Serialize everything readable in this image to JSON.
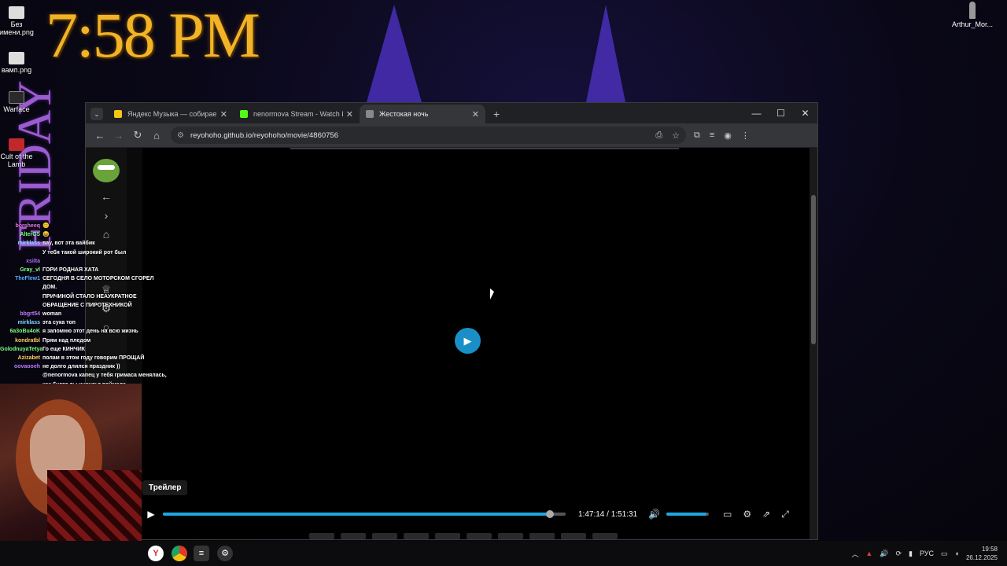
{
  "desktop": {
    "clock": "7:58 PM",
    "day_text": "FRIDAY",
    "icons": [
      {
        "label": "Без имени.png"
      },
      {
        "label": "вамп.png"
      },
      {
        "label": "Warface"
      },
      {
        "label": "Cult of the Lamb"
      }
    ],
    "user": "Arthur_Mor..."
  },
  "browser": {
    "tabs": [
      {
        "title": "Яндекс Музыка — собираем м",
        "color": "#f5c518"
      },
      {
        "title": "nenormova Stream - Watch Liv",
        "color": "#53fc18"
      },
      {
        "title": "Жестокая ночь",
        "color": "#888888",
        "active": true
      }
    ],
    "new_tab": "+",
    "address": "reyohoho.github.io/reyohoho/movie/4860756",
    "window_controls": {
      "minimize": "—",
      "maximize": "☐",
      "close": "✕"
    }
  },
  "player": {
    "trailer_label": "Трейлер",
    "current_time": "1:47:14",
    "separator": "/",
    "duration": "1:51:31",
    "progress": 0.961,
    "volume": 0.95,
    "accent": "#1ea7e0"
  },
  "chat": [
    {
      "user": "borsheeq",
      "msg": "😊",
      "color": "#e07be0"
    },
    {
      "user": "AlterCS",
      "msg": "😆",
      "color": "#7bff7b"
    },
    {
      "user": "mirklass",
      "msg": "вау, вот эта вайбик",
      "color": "#7fd7ff"
    },
    {
      "user": "",
      "msg": "У тебя такой широкий рот был",
      "color": "#ff6a6a"
    },
    {
      "user": "xsiita",
      "msg": "",
      "color": "#b06bff"
    },
    {
      "user": "Gray_vl",
      "msg": "ГОРИ РОДНАЯ ХАТА",
      "color": "#8aff8a"
    },
    {
      "user": "TheFlew1",
      "msg": "СЕГОДНЯ В СЕЛО МОТОРСКОМ СГОРЕЛ ДОМ.",
      "color": "#5ab0ff"
    },
    {
      "user": "",
      "msg": "ПРИЧИНОЙ СТАЛО НЕАУКРАТНОЕ",
      "color": "#5ab0ff"
    },
    {
      "user": "",
      "msg": "ОБРАЩЕНИЕ С ПИРОТЕХНИКОЙ",
      "color": "#5ab0ff"
    },
    {
      "user": "bbgrt54",
      "msg": "woman",
      "color": "#c07bff"
    },
    {
      "user": "mirklass",
      "msg": "эта сука топ",
      "color": "#7fd7ff"
    },
    {
      "user": "6a3oBu4oK",
      "msg": "я запомню этот день на всю жизнь",
      "color": "#7bff7b"
    },
    {
      "user": "kondratbl",
      "msg": "Прям над пледом",
      "color": "#ffcf5a"
    },
    {
      "user": "GolodnuyaTetya",
      "msg": "Го еще КИНЧИК",
      "color": "#7bff7b"
    },
    {
      "user": "Azizabet",
      "msg": "полам в этом году говорим ПРОЩАЙ",
      "color": "#ffcf5a"
    },
    {
      "user": "oovaooeh",
      "msg": "не долго длился праздник ))",
      "color": "#c07bff"
    },
    {
      "user": "",
      "msg": "@nenormova капец у тебя гримаса менялась,",
      "color": "#5ab0ff"
    },
    {
      "user": "",
      "msg": "как будто ты инсульт поймала",
      "color": "#5ab0ff"
    }
  ],
  "taskbar": {
    "lang": "РУС",
    "time": "19:58",
    "date": "26.12.2025"
  }
}
